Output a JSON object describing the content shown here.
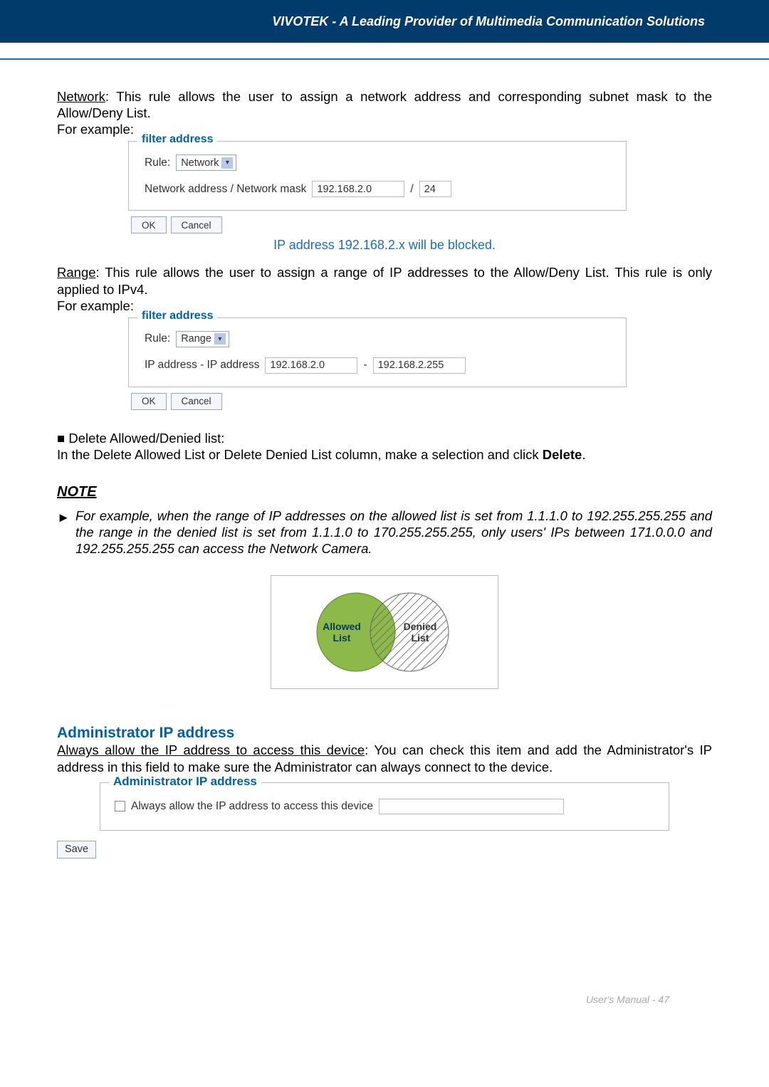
{
  "header": {
    "title": "VIVOTEK - A Leading Provider of Multimedia Communication Solutions"
  },
  "network": {
    "label": "Network",
    "desc1": ": This rule allows the user to assign a network address and corresponding subnet mask to the Allow/Deny List.",
    "for_example": "For example:"
  },
  "fs1": {
    "legend": "filter address",
    "rule_label": "Rule:",
    "rule_value": "Network",
    "field_label": "Network address / Network mask",
    "addr": "192.168.2.0",
    "slash": "/",
    "mask": "24",
    "ok": "OK",
    "cancel": "Cancel",
    "caption": "IP address 192.168.2.x will be blocked."
  },
  "range": {
    "label": "Range",
    "desc1": ": This rule allows the user to assign a range of IP addresses to the Allow/Deny List. This rule is only applied to IPv4.",
    "for_example": "For example:"
  },
  "fs2": {
    "legend": "filter address",
    "rule_label": "Rule:",
    "rule_value": "Range",
    "field_label": "IP address - IP address",
    "addr1": "192.168.2.0",
    "dash": "-",
    "addr2": "192.168.2.255",
    "ok": "OK",
    "cancel": "Cancel"
  },
  "delete_section": {
    "bullet": "■",
    "title": "Delete Allowed/Denied list:",
    "body_pre": "In the Delete Allowed List or Delete Denied List column, make a selection and click ",
    "body_bold": "Delete",
    "body_post": "."
  },
  "note": {
    "heading": "NOTE",
    "body": "For example, when the range of IP addresses on the allowed list is set from 1.1.1.0 to 192.255.255.255 and the range in the denied list is set from 1.1.1.0 to 170.255.255.255, only users' IPs between 171.0.0.0 and 192.255.255.255 can access the Network Camera."
  },
  "venn": {
    "allowed_l1": "Allowed",
    "allowed_l2": "List",
    "denied_l1": "Denied",
    "denied_l2": "List"
  },
  "admin": {
    "heading": "Administrator IP address",
    "label": "Always allow the IP address to access this device",
    "desc": ": You can check this item and add the Administrator's IP address in this field to make sure the Administrator can always connect to the device.",
    "legend": "Administrator IP address",
    "checkbox_label": "Always allow the IP address to access this device",
    "save": "Save"
  },
  "footer": {
    "text": "User's Manual - 47"
  }
}
